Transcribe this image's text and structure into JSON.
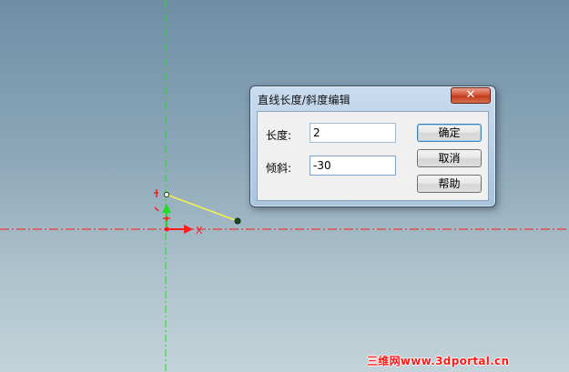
{
  "dialog": {
    "title": "直线长度/斜度编辑",
    "close_glyph": "✕",
    "length_label": "长度:",
    "length_value": "2",
    "angle_label": "倾斜:",
    "angle_value": "-30",
    "ok_label": "确定",
    "cancel_label": "取消",
    "help_label": "帮助"
  },
  "canvas": {
    "x_axis_label": "X",
    "colors": {
      "x_axis": "#ff1a1a",
      "y_axis": "#22dd22",
      "sketch_line": "#f2f250",
      "line_endpoint": "#1d4a1d"
    }
  },
  "watermark": "三维网www.3dportal.cn"
}
